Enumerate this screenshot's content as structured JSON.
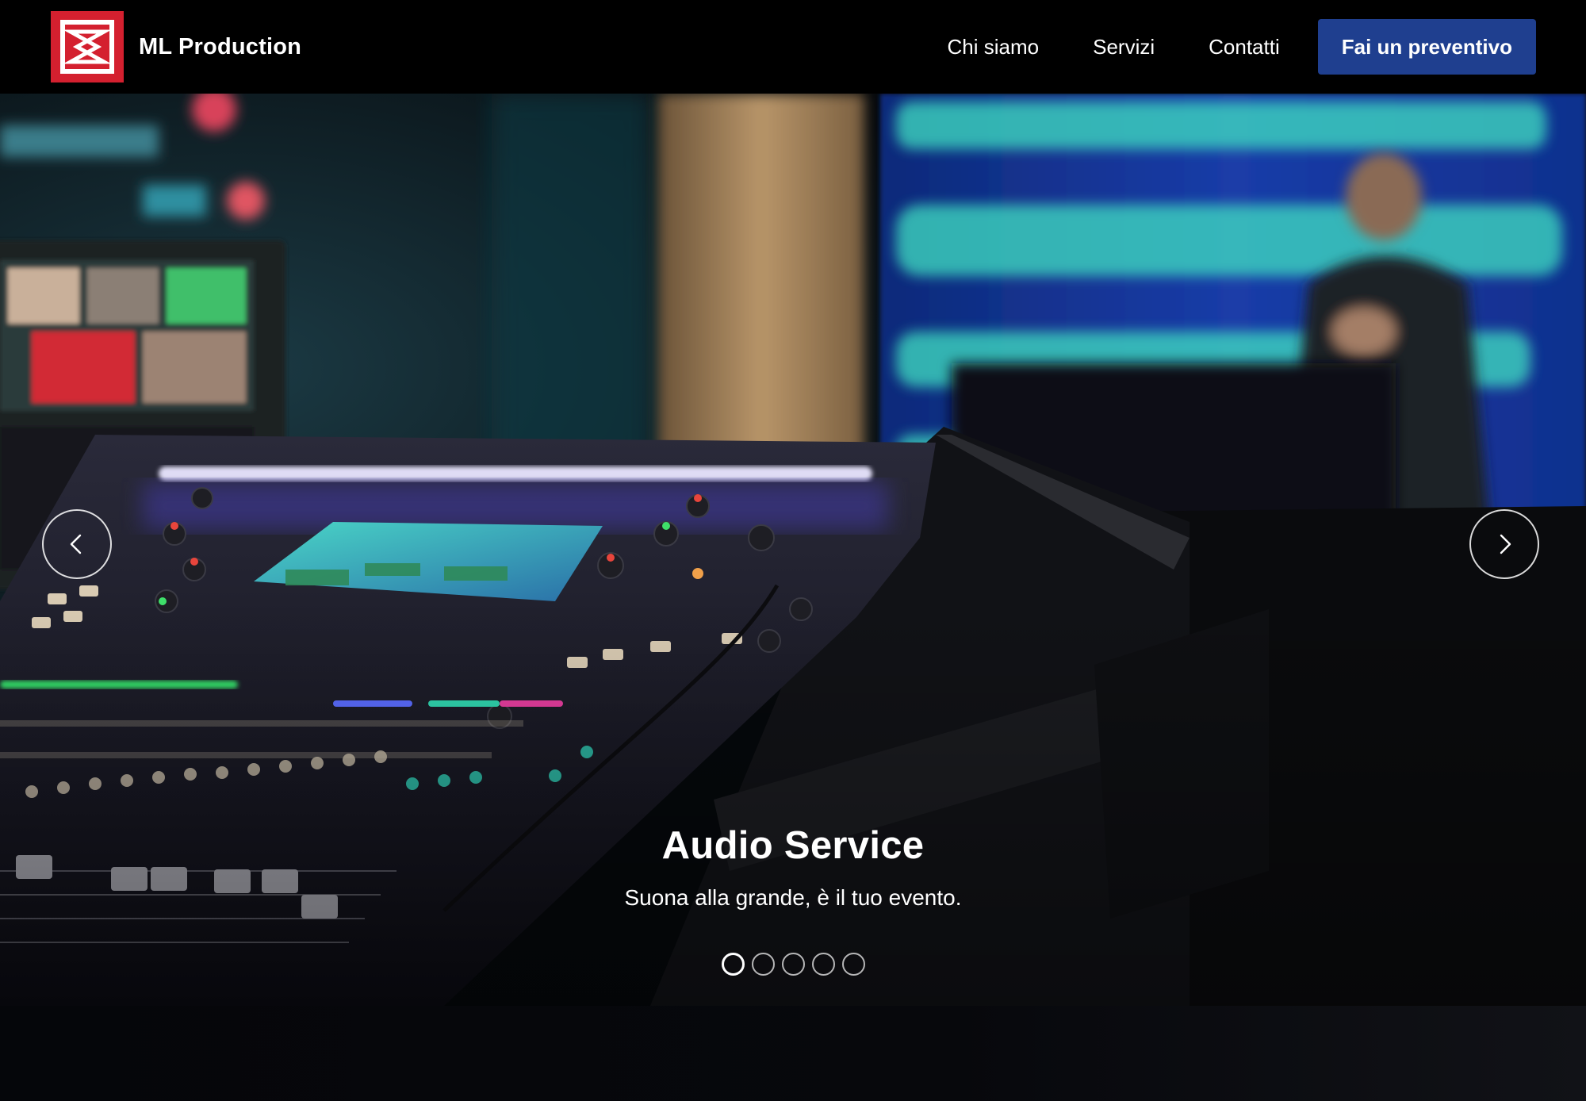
{
  "brand": {
    "name": "ML Production",
    "logo_icon": "play-triangle-logo-icon",
    "logo_color": "#d4202f"
  },
  "nav": {
    "links": [
      "Chi siamo",
      "Servizi",
      "Contatti"
    ],
    "cta_label": "Fai un preventivo",
    "cta_color": "#1f3f8f"
  },
  "hero": {
    "title": "Audio Service",
    "subtitle": "Suona alla grande, è il tuo evento.",
    "slides_count": 5,
    "active_slide": 1,
    "prev_icon": "chevron-left-icon",
    "next_icon": "chevron-right-icon"
  }
}
